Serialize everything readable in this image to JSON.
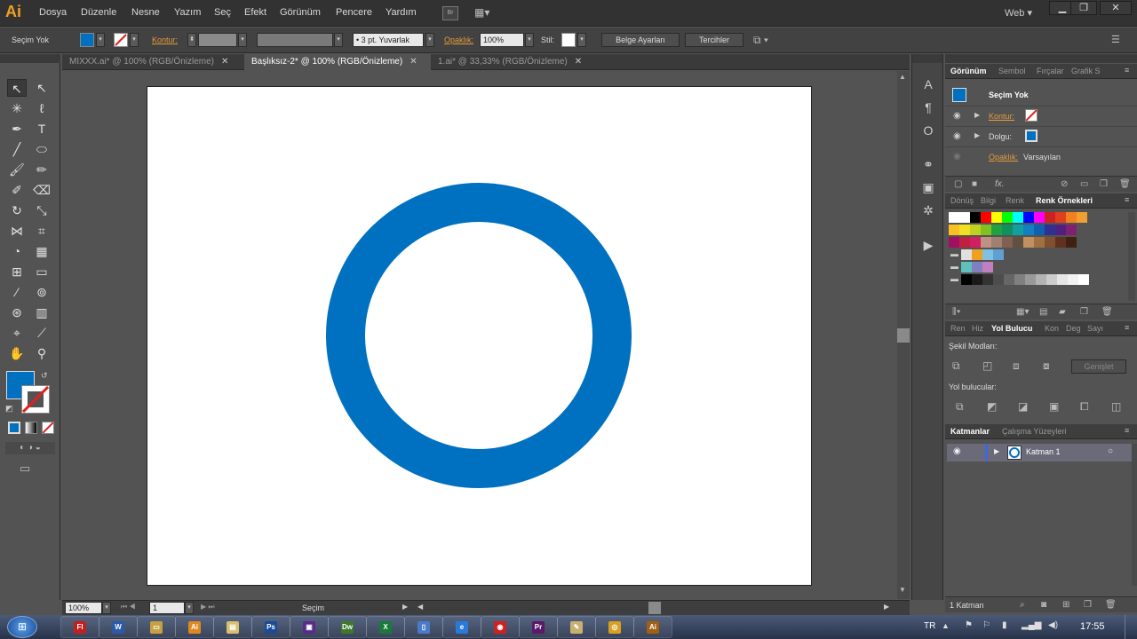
{
  "app": {
    "logo": "Ai"
  },
  "menu": [
    "Dosya",
    "Düzenle",
    "Nesne",
    "Yazım",
    "Seç",
    "Efekt",
    "Görünüm",
    "Pencere",
    "Yardım"
  ],
  "bridge_label": "Br",
  "workspace": "Web",
  "window_controls": {
    "minimize": "▁",
    "restore": "❐",
    "close": "✕"
  },
  "control_bar": {
    "selection_label": "Seçim Yok",
    "stroke_label": "Kontur:",
    "brush_value": "3 pt. Yuvarlak",
    "opacity_label": "Opaklık:",
    "opacity_value": "100%",
    "style_label": "Stil:",
    "doc_settings": "Belge Ayarları",
    "preferences": "Tercihler"
  },
  "tabs": [
    {
      "label": "MIXXX.ai* @ 100% (RGB/Önizleme)",
      "active": false
    },
    {
      "label": "Başlıksız-2* @ 100% (RGB/Önizleme)",
      "active": true
    },
    {
      "label": "1.ai* @ 33,33% (RGB/Önizleme)",
      "active": false
    }
  ],
  "tab_close": "✕",
  "artwork": {
    "ring_color": "#0070c0"
  },
  "status": {
    "zoom": "100%",
    "page": "1",
    "mode": "Seçim"
  },
  "appearance_panel": {
    "tabs": [
      "Görünüm",
      "Sembol",
      "Fırçalar",
      "Grafik S"
    ],
    "title": "Seçim Yok",
    "rows": [
      {
        "label": "Kontur:"
      },
      {
        "label": "Dolgu:"
      },
      {
        "label": "Opaklık:",
        "value": "Varsayılan"
      }
    ]
  },
  "swatches_panel": {
    "tabs": [
      "Dönüş",
      "Bilgi",
      "Renk",
      "Renk Örnekleri"
    ],
    "rows": [
      [
        "#ffffff",
        "#ffffff",
        "#000000",
        "#ff0000",
        "#ffff00",
        "#00ff00",
        "#00ffff",
        "#0000ff",
        "#ff00ff",
        "#cc2222",
        "#e04020",
        "#f08020",
        "#f0a030"
      ],
      [
        "#f8c020",
        "#f0e020",
        "#c0d020",
        "#80c020",
        "#20a040",
        "#10905a",
        "#10a0a0",
        "#1080c0",
        "#1060b0",
        "#303090",
        "#502080",
        "#802070"
      ],
      [
        "#a01060",
        "#c02040",
        "#d02060",
        "#c09080",
        "#a08070",
        "#806050",
        "#605040",
        "#c09060",
        "#a07040",
        "#805030",
        "#603020",
        "#402010"
      ],
      [
        "#e0e0e0",
        "#f0a020",
        "#80c0e0",
        "#60a0d0"
      ],
      [
        "#60c0c0",
        "#8080c0",
        "#c080c0"
      ],
      [
        "#000000",
        "#1a1a1a",
        "#333333",
        "#4d4d4d",
        "#666666",
        "#808080",
        "#999999",
        "#b3b3b3",
        "#cccccc",
        "#e6e6e6",
        "#f2f2f2",
        "#ffffff"
      ]
    ]
  },
  "pathfinder_panel": {
    "tabs": [
      "Ren",
      "Hiz",
      "Yol Bulucu",
      "Kon",
      "Deg",
      "Sayı"
    ],
    "shape_modes": "Şekil Modları:",
    "expand": "Genişlet",
    "pathfinders": "Yol bulucular:"
  },
  "layers_panel": {
    "tabs": [
      "Katmanlar",
      "Çalışma Yüzeyleri"
    ],
    "layer_name": "Katman 1",
    "footer": "1 Katman"
  },
  "taskbar": {
    "lang": "TR",
    "time": "17:55",
    "apps": [
      {
        "label": "Fl",
        "color": "#c02020"
      },
      {
        "label": "W",
        "color": "#2a5aa8"
      },
      {
        "label": "▭",
        "color": "#c8a040"
      },
      {
        "label": "Ai",
        "color": "#e08820"
      },
      {
        "label": "▤",
        "color": "#d8c070"
      },
      {
        "label": "Ps",
        "color": "#1a4a9a"
      },
      {
        "label": "▣",
        "color": "#5a2a8a"
      },
      {
        "label": "Dw",
        "color": "#3a7a2a"
      },
      {
        "label": "X",
        "color": "#1a7a3a"
      },
      {
        "label": "▯",
        "color": "#4a7ac8"
      },
      {
        "label": "e",
        "color": "#2a7ad8"
      },
      {
        "label": "◉",
        "color": "#d02020"
      },
      {
        "label": "Pr",
        "color": "#5a1a6a"
      },
      {
        "label": "✎",
        "color": "#c8b070"
      },
      {
        "label": "◎",
        "color": "#d8a020"
      },
      {
        "label": "Ai",
        "color": "#a06010"
      }
    ]
  }
}
